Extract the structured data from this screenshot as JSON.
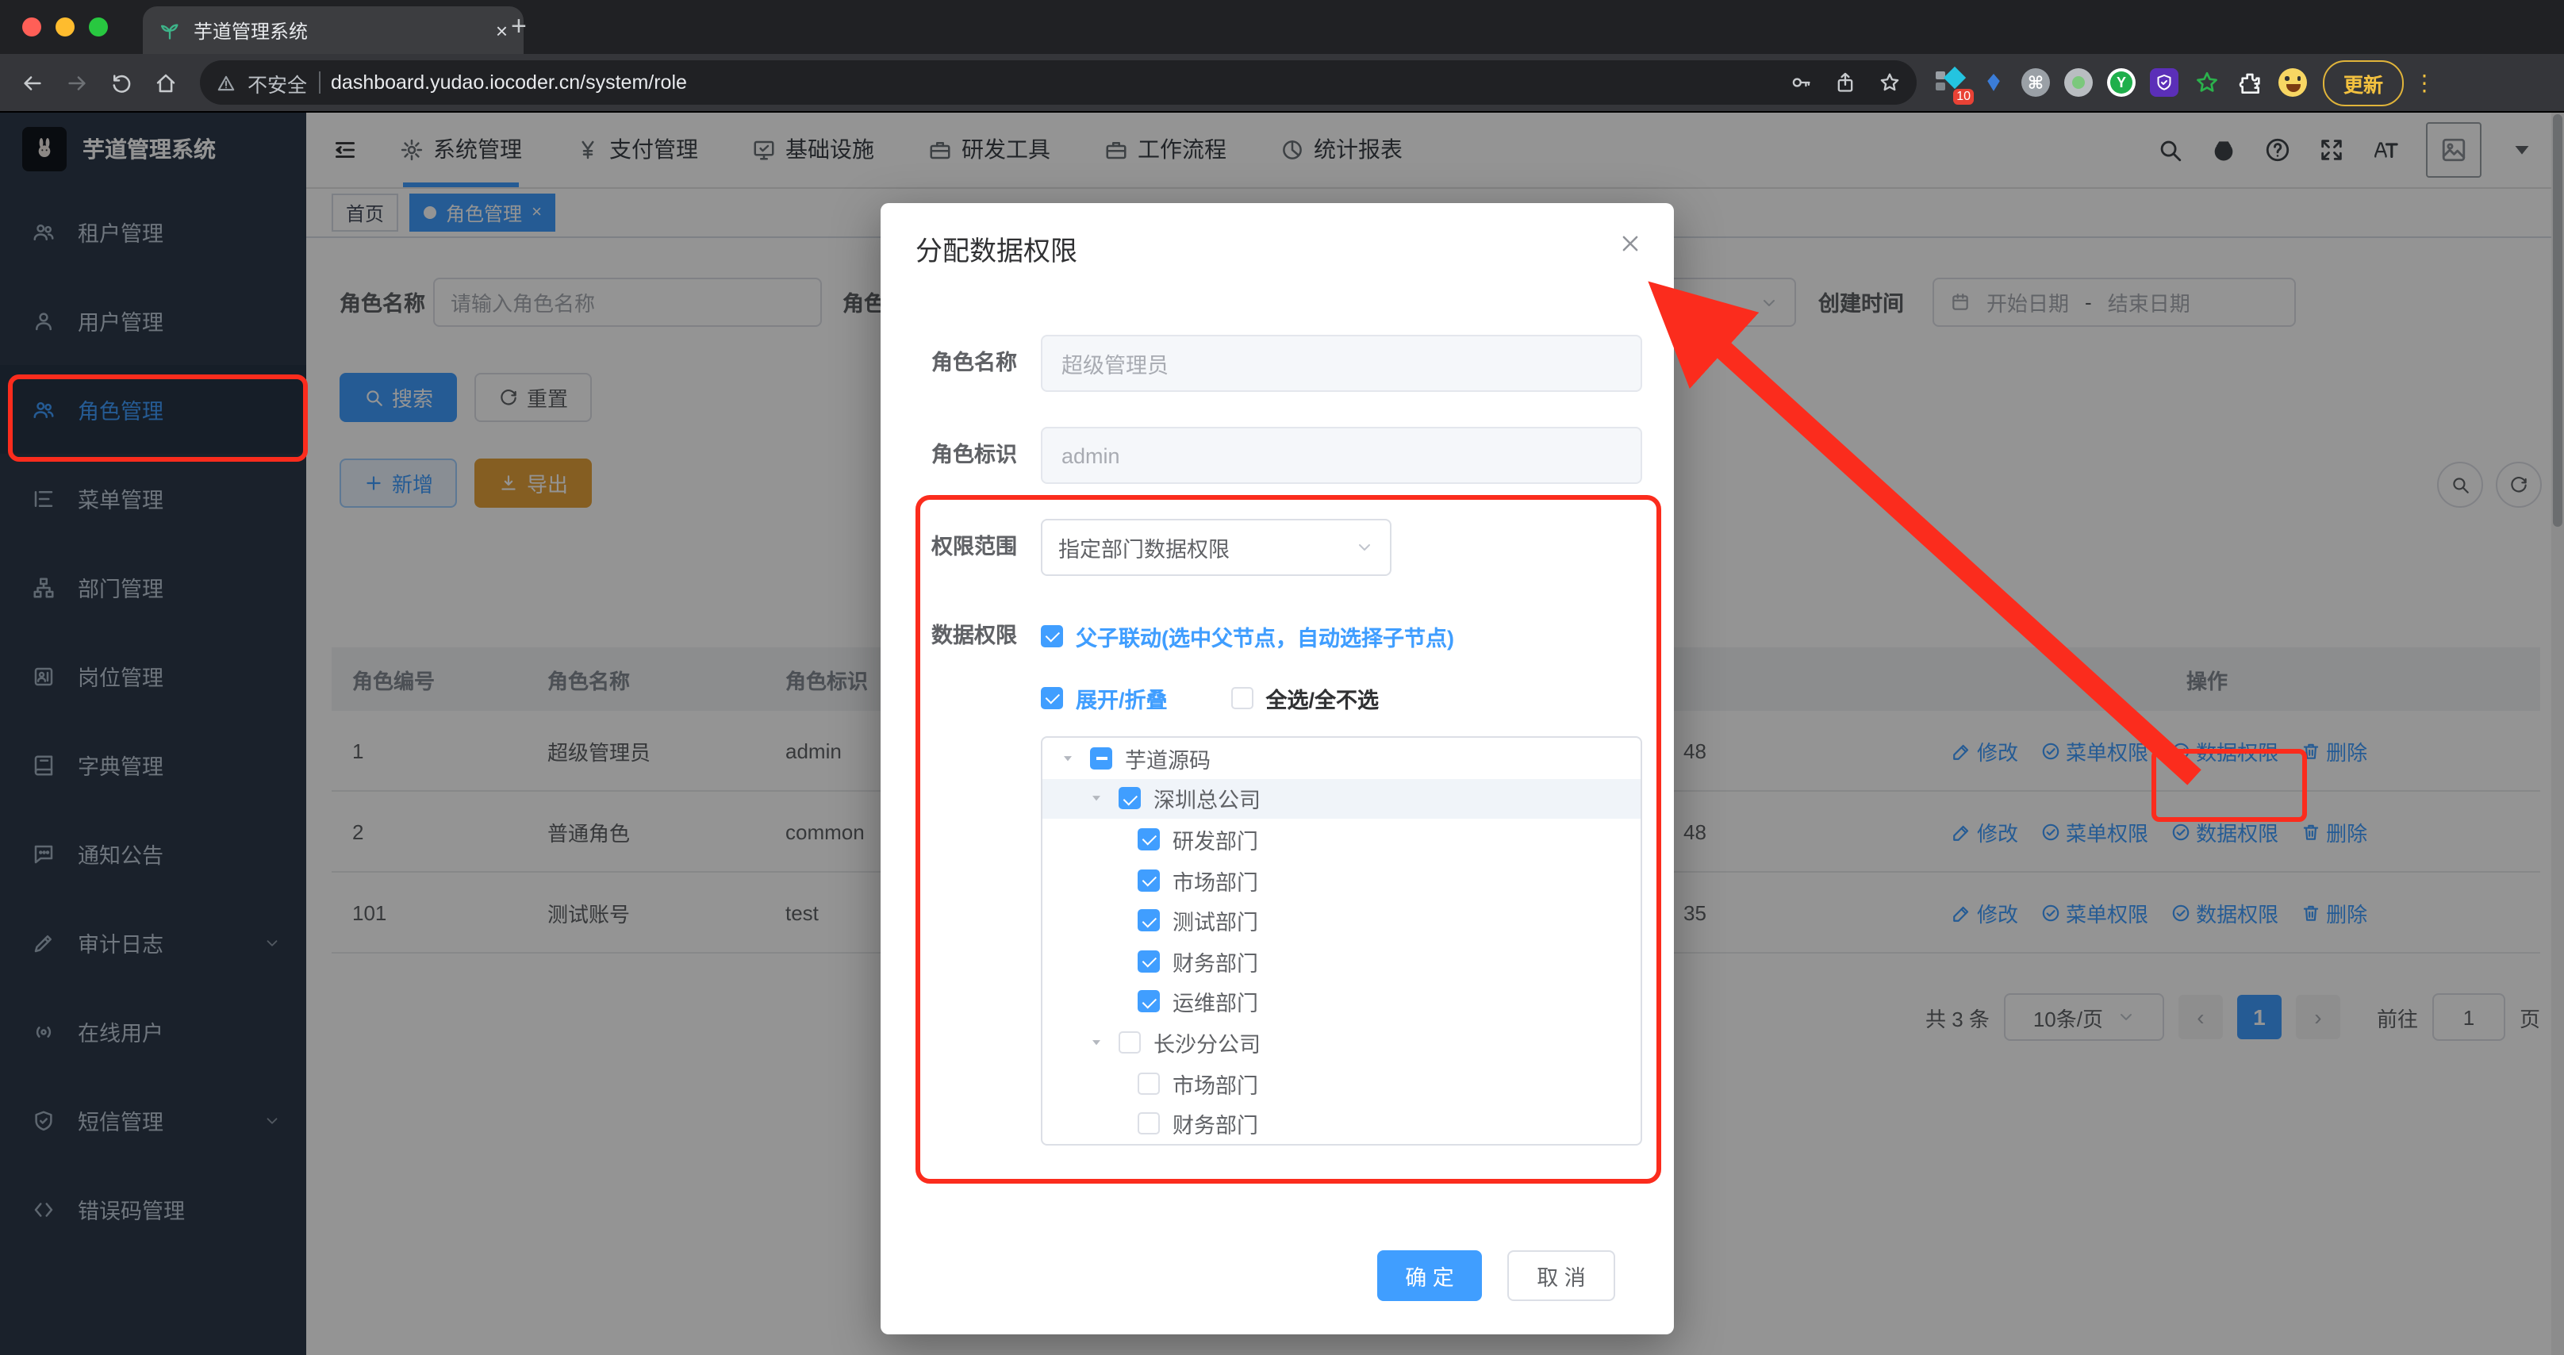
{
  "browser": {
    "tab_title": "芋道管理系统",
    "tab_close": "×",
    "new_tab": "+",
    "security_label": "不安全",
    "url": "dashboard.yudao.iocoder.cn/system/role",
    "extension_badge": "10",
    "update_label": "更新",
    "menu_dots": "⋮"
  },
  "sidebar": {
    "title": "芋道管理系统",
    "items": [
      {
        "icon": "people-icon",
        "label": "租户管理"
      },
      {
        "icon": "person-icon",
        "label": "用户管理"
      },
      {
        "icon": "people-icon",
        "label": "角色管理",
        "active": true
      },
      {
        "icon": "menu-tree-icon",
        "label": "菜单管理"
      },
      {
        "icon": "org-icon",
        "label": "部门管理"
      },
      {
        "icon": "badge-icon",
        "label": "岗位管理"
      },
      {
        "icon": "book-icon",
        "label": "字典管理"
      },
      {
        "icon": "chat-icon",
        "label": "通知公告"
      },
      {
        "icon": "pen-icon",
        "label": "审计日志",
        "chevron": true
      },
      {
        "icon": "online-icon",
        "label": "在线用户"
      },
      {
        "icon": "shield-icon",
        "label": "短信管理",
        "chevron": true
      },
      {
        "icon": "code-icon",
        "label": "错误码管理"
      }
    ]
  },
  "topnav": {
    "menus": [
      {
        "icon": "gear-icon",
        "label": "系统管理",
        "active": true
      },
      {
        "icon": "yen-icon",
        "label": "支付管理"
      },
      {
        "icon": "monitor-icon",
        "label": "基础设施"
      },
      {
        "icon": "briefcase-icon",
        "label": "研发工具"
      },
      {
        "icon": "briefcase-icon",
        "label": "工作流程"
      },
      {
        "icon": "pie-icon",
        "label": "统计报表"
      }
    ]
  },
  "tags": {
    "home": "首页",
    "active": "角色管理",
    "close": "×"
  },
  "search": {
    "name_label": "角色名称",
    "name_placeholder": "请输入角色名称",
    "code_label": "角色标识",
    "time_label": "创建时间",
    "start_placeholder": "开始日期",
    "range_separator": "-",
    "end_placeholder": "结束日期"
  },
  "toolbar": {
    "search": "搜索",
    "reset": "重置",
    "add": "新增",
    "export": "导出"
  },
  "table": {
    "headers": {
      "id": "角色编号",
      "name": "角色名称",
      "code": "角色标识",
      "actions": "操作"
    },
    "rows": [
      {
        "id": "1",
        "name": "超级管理员",
        "code": "admin",
        "order": "48"
      },
      {
        "id": "2",
        "name": "普通角色",
        "code": "common",
        "order": "48"
      },
      {
        "id": "101",
        "name": "测试账号",
        "code": "test",
        "order": "35"
      }
    ],
    "actions": {
      "edit": "修改",
      "menu_perm": "菜单权限",
      "data_perm": "数据权限",
      "delete": "删除"
    }
  },
  "pagination": {
    "total": "共 3 条",
    "page_size": "10条/页",
    "prev": "‹",
    "current": "1",
    "next": "›",
    "goto_label": "前往",
    "goto_value": "1",
    "page_unit": "页"
  },
  "modal": {
    "title": "分配数据权限",
    "close": "×",
    "fields": {
      "name_label": "角色名称",
      "name_value": "超级管理员",
      "code_label": "角色标识",
      "code_value": "admin",
      "scope_label": "权限范围",
      "scope_value": "指定部门数据权限",
      "perm_label": "数据权限"
    },
    "options": {
      "linkage": "父子联动(选中父节点，自动选择子节点)",
      "expand": "展开/折叠",
      "select_all": "全选/全不选"
    },
    "tree": [
      {
        "label": "芋道源码",
        "level": 0,
        "state": "indeterminate",
        "caret": true
      },
      {
        "label": "深圳总公司",
        "level": 1,
        "state": "checked",
        "caret": true,
        "highlight": true
      },
      {
        "label": "研发部门",
        "level": 2,
        "state": "checked"
      },
      {
        "label": "市场部门",
        "level": 2,
        "state": "checked"
      },
      {
        "label": "测试部门",
        "level": 2,
        "state": "checked"
      },
      {
        "label": "财务部门",
        "level": 2,
        "state": "checked"
      },
      {
        "label": "运维部门",
        "level": 2,
        "state": "checked"
      },
      {
        "label": "长沙分公司",
        "level": 1,
        "state": "unchecked",
        "caret": true
      },
      {
        "label": "市场部门",
        "level": 2,
        "state": "unchecked"
      },
      {
        "label": "财务部门",
        "level": 2,
        "state": "unchecked"
      }
    ],
    "footer": {
      "confirm": "确 定",
      "cancel": "取 消"
    }
  },
  "colors": {
    "primary": "#409eff",
    "warning": "#e6a23c",
    "annotation": "#fb2c1d",
    "sidebar_bg": "#2d3a4b"
  }
}
